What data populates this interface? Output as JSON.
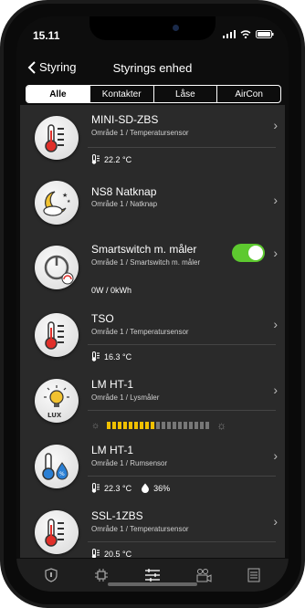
{
  "status": {
    "time": "15.11"
  },
  "nav": {
    "back_label": "Styring",
    "title": "Styrings enhed"
  },
  "segments": [
    "Alle",
    "Kontakter",
    "Låse",
    "AirCon"
  ],
  "devices": [
    {
      "name": "MINI-SD-ZBS",
      "area": "Område 1 / Temperatursensor",
      "value": "22.2 °C",
      "icon": "thermometer-icon"
    },
    {
      "name": "NS8 Natknap",
      "area": "Område 1 / Natknap",
      "icon": "moon-icon"
    },
    {
      "name": "Smartswitch m. måler",
      "area": "Område 1 / Smartswitch m. måler",
      "value": "0W / 0kWh",
      "icon": "power-icon",
      "toggle_on": true
    },
    {
      "name": "TSO",
      "area": "Område 1 / Temperatursensor",
      "value": "16.3 °C",
      "icon": "thermometer-icon"
    },
    {
      "name": "LM HT-1",
      "area": "Område 1 / Lysmåler",
      "icon": "lux-icon",
      "lux_level": 0.47,
      "icon_label": "LUX"
    },
    {
      "name": "LM HT-1",
      "area": "Område 1 / Rumsensor",
      "value": "22.3 °C",
      "humidity": "36%",
      "icon": "humidity-icon"
    },
    {
      "name": "SSL-1ZBS",
      "area": "Område 1 / Temperatursensor",
      "value": "20.5 °C",
      "icon": "thermometer-icon"
    }
  ],
  "tabs": [
    "shield-icon",
    "chip-icon",
    "sliders-icon",
    "camera-icon",
    "list-icon"
  ],
  "colors": {
    "toggle": "#5dc92f",
    "lux_bar": "#f0c000",
    "thermo_red": "#e0302a",
    "drop_blue": "#2a7fd4"
  }
}
